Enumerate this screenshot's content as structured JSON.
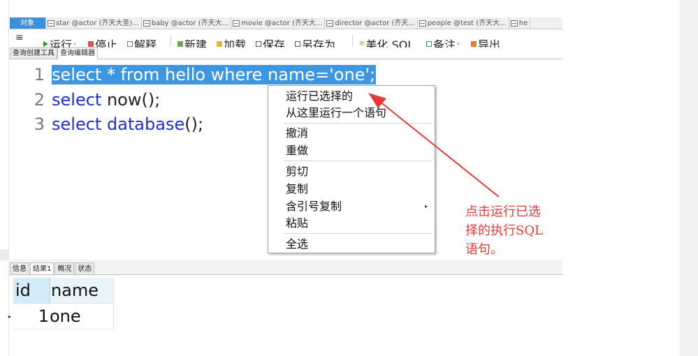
{
  "tabs": [
    {
      "label": "对象",
      "active": true,
      "icon": ""
    },
    {
      "label": "star @actor (齐天大圣)...",
      "active": false,
      "icon": "table-icon"
    },
    {
      "label": "baby @actor (齐天大...",
      "active": false,
      "icon": "table-icon"
    },
    {
      "label": "movie @actor (齐天大...",
      "active": false,
      "icon": "table-icon"
    },
    {
      "label": "director @actor (齐天...",
      "active": false,
      "icon": "table-icon"
    },
    {
      "label": "people @test (齐天大...",
      "active": false,
      "icon": "table-icon"
    },
    {
      "label": "he",
      "active": false,
      "icon": "query-icon"
    }
  ],
  "toolbar": {
    "menu_icon": "≡",
    "run": "运行",
    "run_caret": "·",
    "stop": "停止",
    "explain": "解释",
    "new": "新建",
    "load": "加载",
    "save": "保存",
    "save_as": "另存为",
    "beautify": "美化 SQL",
    "comment": "备注",
    "comment_caret": "·",
    "export": "导出"
  },
  "subtabs": {
    "builder": "查询创建工具",
    "editor": "查询编辑器"
  },
  "editor": {
    "lines": [
      {
        "num": "1",
        "parts": [
          {
            "t": "select * from hello where name='one';",
            "c": "sel"
          }
        ]
      },
      {
        "num": "2",
        "parts": [
          {
            "t": "select",
            "c": "kw"
          },
          {
            "t": " now();",
            "c": "tx"
          }
        ]
      },
      {
        "num": "3",
        "parts": [
          {
            "t": "select",
            "c": "kw"
          },
          {
            "t": " ",
            "c": "tx"
          },
          {
            "t": "database",
            "c": "kw"
          },
          {
            "t": "();",
            "c": "tx"
          }
        ]
      }
    ]
  },
  "context_menu": {
    "run_selected": "运行已选择的",
    "run_from_here": "从这里运行一个语句",
    "undo": "撤消",
    "redo": "重做",
    "cut": "剪切",
    "copy": "复制",
    "copy_quoted": "含引号复制",
    "paste": "粘贴",
    "select_all": "全选",
    "submenu_arrow": "▸"
  },
  "annotation": {
    "note": "点击运行已选择的执行SQL语句。",
    "note_line1": "点击运行已选",
    "note_line2": "择的执行SQL",
    "note_line3": "语句。",
    "color": "#e53a3a"
  },
  "result_tabs": {
    "info": "信息",
    "result1": "结果1",
    "overview": "概况",
    "status": "状态"
  },
  "result_grid": {
    "columns": [
      "id",
      "name"
    ],
    "rows": [
      [
        "1",
        "one"
      ]
    ],
    "row_pointer": "▸"
  },
  "colors": {
    "selection": "#3d96e0",
    "keyword": "#1f2fd0",
    "active_tab": "#3c8fdb"
  }
}
